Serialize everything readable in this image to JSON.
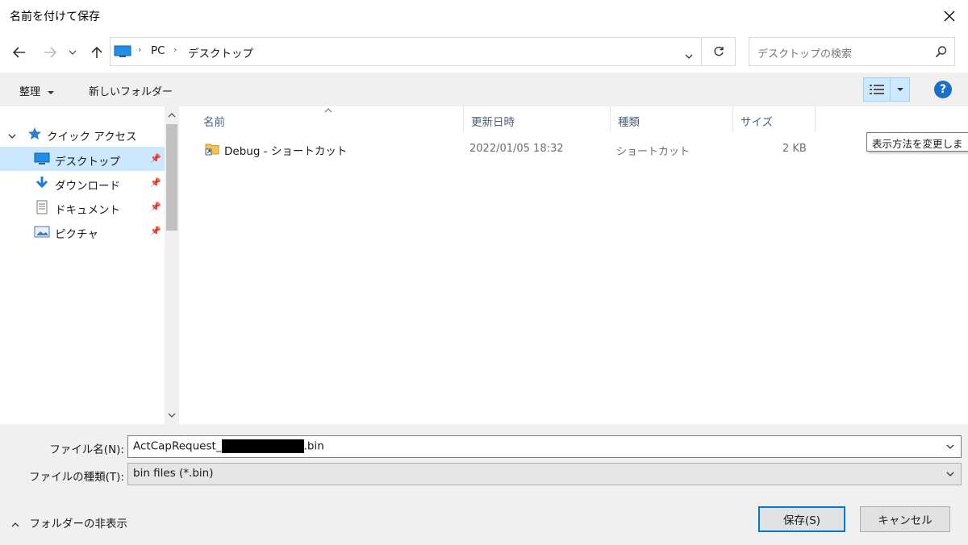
{
  "window": {
    "title": "名前を付けて保存",
    "close_icon": "close-icon"
  },
  "nav": {
    "back_icon": "arrow-left-icon",
    "forward_icon": "arrow-right-icon",
    "recent_icon": "chevron-down-icon",
    "up_icon": "arrow-up-icon",
    "breadcrumb": [
      "PC",
      "デスクトップ"
    ],
    "refresh_icon": "refresh-icon",
    "search_placeholder": "デスクトップの検索"
  },
  "toolbar": {
    "organize_label": "整理",
    "new_folder_label": "新しいフォルダー",
    "view_tooltip": "表示方法を変更しま"
  },
  "sidebar": {
    "quick_access_label": "クイック アクセス",
    "items": [
      {
        "label": "デスクトップ",
        "icon": "desktop-icon",
        "selected": true
      },
      {
        "label": "ダウンロード",
        "icon": "download-icon",
        "selected": false
      },
      {
        "label": "ドキュメント",
        "icon": "document-icon",
        "selected": false
      },
      {
        "label": "ピクチャ",
        "icon": "picture-icon",
        "selected": false
      }
    ]
  },
  "file_list": {
    "columns": [
      "名前",
      "更新日時",
      "種類",
      "サイズ"
    ],
    "rows": [
      {
        "name": "Debug - ショートカット",
        "modified": "2022/01/05 18:32",
        "type": "ショートカット",
        "size": "2 KB"
      }
    ]
  },
  "form": {
    "filename_label": "ファイル名(N):",
    "filename_value_prefix": "ActCapRequest_",
    "filename_value_suffix": ".bin",
    "filetype_label": "ファイルの種類(T):",
    "filetype_value": "bin files (*.bin)",
    "hide_folders_label": "フォルダーの非表示",
    "save_label": "保存(S)",
    "cancel_label": "キャンセル"
  },
  "colors": {
    "selection": "#cce8ff",
    "accent": "#0078d7",
    "help": "#1a6fc9"
  }
}
